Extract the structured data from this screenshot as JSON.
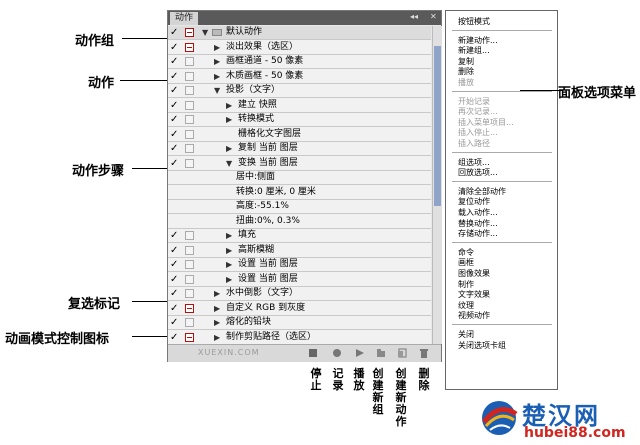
{
  "panel": {
    "tab_label": "动作",
    "rows": [
      {
        "label": "默认动作",
        "indent": 1,
        "type": "set",
        "check": "✓",
        "box": "red"
      },
      {
        "label": "淡出效果（选区）",
        "indent": 2,
        "type": "action",
        "check": "✓",
        "box": "red"
      },
      {
        "label": "画框通道 - 50 像素",
        "indent": 2,
        "type": "action",
        "check": "✓",
        "box": "plain"
      },
      {
        "label": "木质画框 - 50 像素",
        "indent": 2,
        "type": "action",
        "check": "✓",
        "box": "plain"
      },
      {
        "label": "投影（文字）",
        "indent": 2,
        "type": "action-open",
        "check": "✓",
        "box": "plain"
      },
      {
        "label": "建立 快照",
        "indent": 3,
        "type": "step",
        "check": "✓",
        "box": "plain"
      },
      {
        "label": "转换模式",
        "indent": 3,
        "type": "step",
        "check": "✓",
        "box": "plain"
      },
      {
        "label": "栅格化文字图层",
        "indent": 3,
        "type": "step-noarrow",
        "check": "✓",
        "box": "plain"
      },
      {
        "label": "复制 当前 图层",
        "indent": 3,
        "type": "step",
        "check": "✓",
        "box": "plain"
      },
      {
        "label": "变换 当前 图层",
        "indent": 3,
        "type": "step-open",
        "check": "✓",
        "box": "plain"
      },
      {
        "label": "居中:侧面",
        "indent": 4,
        "type": "detail",
        "check": "",
        "box": "none"
      },
      {
        "label": "转换:0 厘米, 0 厘米",
        "indent": 4,
        "type": "detail",
        "check": "",
        "box": "none"
      },
      {
        "label": "高度:-55.1%",
        "indent": 4,
        "type": "detail",
        "check": "",
        "box": "none"
      },
      {
        "label": "扭曲:0%, 0.3%",
        "indent": 4,
        "type": "detail",
        "check": "",
        "box": "none"
      },
      {
        "label": "填充",
        "indent": 3,
        "type": "step",
        "check": "✓",
        "box": "plain"
      },
      {
        "label": "高斯模糊",
        "indent": 3,
        "type": "step",
        "check": "✓",
        "box": "plain"
      },
      {
        "label": "设置 当前 图层",
        "indent": 3,
        "type": "step",
        "check": "✓",
        "box": "plain"
      },
      {
        "label": "设置 当前 图层",
        "indent": 3,
        "type": "step",
        "check": "✓",
        "box": "plain"
      },
      {
        "label": "水中倒影（文字）",
        "indent": 2,
        "type": "action",
        "check": "✓",
        "box": "plain"
      },
      {
        "label": "自定义 RGB 到灰度",
        "indent": 2,
        "type": "action",
        "check": "✓",
        "box": "red"
      },
      {
        "label": "熔化的铅块",
        "indent": 2,
        "type": "action",
        "check": "✓",
        "box": "plain"
      },
      {
        "label": "制作剪贴路径（选区）",
        "indent": 2,
        "type": "action",
        "check": "✓",
        "box": "red"
      }
    ],
    "watermark": "XUEXIN.COM"
  },
  "annotations": {
    "action_set": "动作组",
    "action": "动作",
    "action_step": "动作步骤",
    "toggle_checkbox": "复选标记",
    "dialog_toggle": "动画模式控制图标",
    "panel_menu": "面板选项菜单"
  },
  "bottom_labels": [
    "停止",
    "记录",
    "播放",
    "创建新组",
    "创建新动作",
    "删除"
  ],
  "menu": {
    "groups": [
      [
        {
          "label": "按钮模式",
          "disabled": false
        }
      ],
      [
        {
          "label": "新建动作...",
          "disabled": false
        },
        {
          "label": "新建组...",
          "disabled": false
        },
        {
          "label": "复制",
          "disabled": false
        },
        {
          "label": "删除",
          "disabled": false
        },
        {
          "label": "播放",
          "disabled": true
        }
      ],
      [
        {
          "label": "开始记录",
          "disabled": true
        },
        {
          "label": "再次记录...",
          "disabled": true
        },
        {
          "label": "插入菜单项目...",
          "disabled": true
        },
        {
          "label": "插入停止...",
          "disabled": true
        },
        {
          "label": "插入路径",
          "disabled": true
        }
      ],
      [
        {
          "label": "组选项...",
          "disabled": false
        },
        {
          "label": "回放选项...",
          "disabled": false
        }
      ],
      [
        {
          "label": "清除全部动作",
          "disabled": false
        },
        {
          "label": "复位动作",
          "disabled": false
        },
        {
          "label": "载入动作...",
          "disabled": false
        },
        {
          "label": "替换动作...",
          "disabled": false
        },
        {
          "label": "存储动作...",
          "disabled": false
        }
      ],
      [
        {
          "label": "命令",
          "disabled": false
        },
        {
          "label": "画框",
          "disabled": false
        },
        {
          "label": "图像效果",
          "disabled": false
        },
        {
          "label": "制作",
          "disabled": false
        },
        {
          "label": "文字效果",
          "disabled": false
        },
        {
          "label": "纹理",
          "disabled": false
        },
        {
          "label": "视频动作",
          "disabled": false
        }
      ],
      [
        {
          "label": "关闭",
          "disabled": false
        },
        {
          "label": "关闭选项卡组",
          "disabled": false
        }
      ]
    ]
  },
  "logo": {
    "brand": "楚汉网",
    "url_text": "hubei88.com"
  },
  "colors": {
    "red_box": "#b01010",
    "scroll_thumb": "#8fa4c8",
    "logo_blue": "#1a5fb4",
    "logo_red": "#d0261f"
  }
}
